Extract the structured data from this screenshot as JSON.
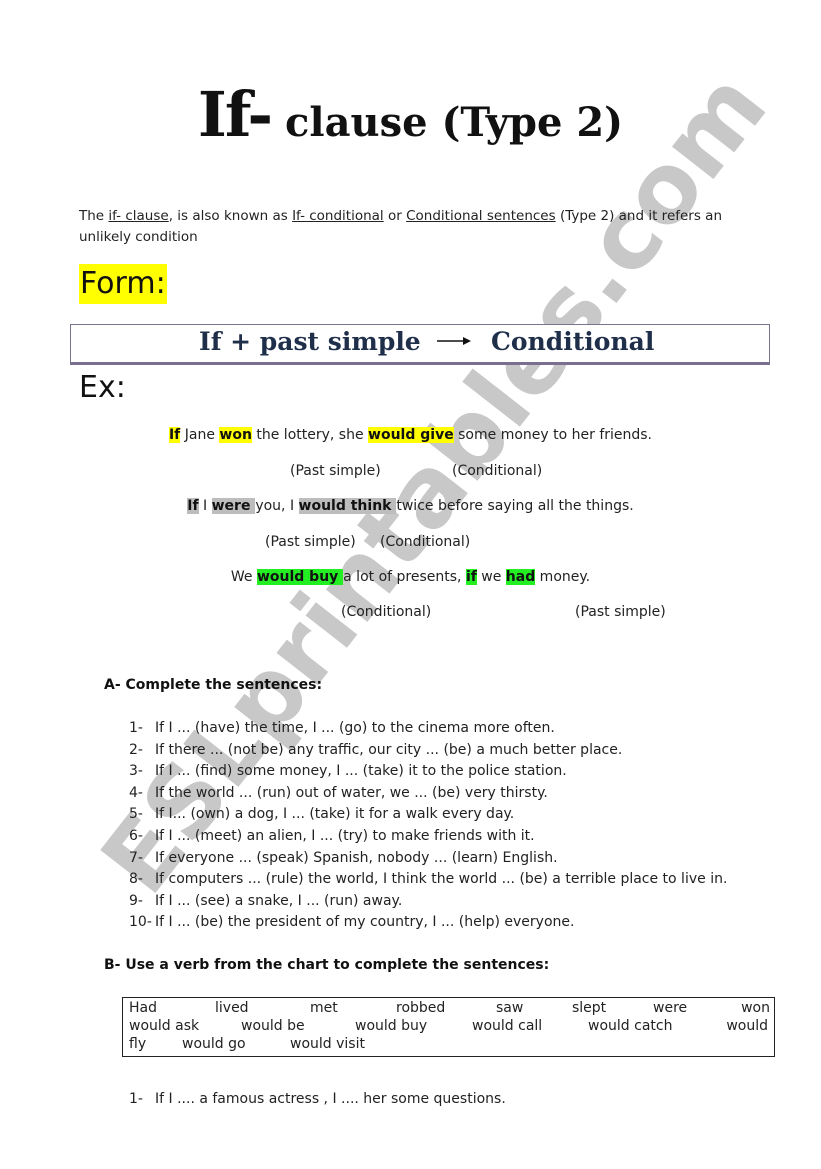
{
  "title": {
    "main": "If-",
    "rest": " clause (Type 2)"
  },
  "intro": {
    "parts": [
      "The ",
      "if- clause",
      ", is also known as ",
      "If- conditional",
      " or ",
      "Conditional sentences",
      " (Type 2) and it refers an unlikely condition"
    ]
  },
  "form": {
    "heading": "Form:",
    "left": "If + past simple",
    "right": "Conditional",
    "arrow_icon": "right-arrow"
  },
  "examples": {
    "heading": "Ex:",
    "sentences": [
      {
        "parts": [
          {
            "text": "If",
            "highlight": "yellow"
          },
          {
            "text": " Jane "
          },
          {
            "text": "won",
            "highlight": "yellow"
          },
          {
            "text": " the lottery, she "
          },
          {
            "text": "would give",
            "highlight": "yellow"
          },
          {
            "text": " some money to her friends."
          }
        ],
        "labels": [
          "(Past simple)",
          "(Conditional)"
        ]
      },
      {
        "parts": [
          {
            "text": "If",
            "highlight": "gray"
          },
          {
            "text": " I "
          },
          {
            "text": "were ",
            "highlight": "gray"
          },
          {
            "text": "you, I "
          },
          {
            "text": "would think ",
            "highlight": "gray"
          },
          {
            "text": "twice before saying all the things."
          }
        ],
        "labels": [
          "(Past simple)",
          "(Conditional)"
        ]
      },
      {
        "parts": [
          {
            "text": "We "
          },
          {
            "text": "would buy ",
            "highlight": "green"
          },
          {
            "text": "a lot of presents, "
          },
          {
            "text": "if",
            "highlight": "green"
          },
          {
            "text": " we "
          },
          {
            "text": "had",
            "highlight": "green"
          },
          {
            "text": " money."
          }
        ],
        "labels": [
          "(Conditional)",
          "(Past simple)"
        ]
      }
    ],
    "highlight_colors": {
      "yellow": "#ffff00",
      "gray": "#bdbdbd",
      "green": "#22ee22"
    }
  },
  "section_a": {
    "heading": "A-  Complete the sentences:",
    "items": [
      {
        "num": "1-",
        "text": "If I ... (have) the time, I ... (go) to the cinema more often."
      },
      {
        "num": "2-",
        "text": "If there ... (not be) any traffic, our city ... (be) a much better place."
      },
      {
        "num": "3-",
        "text": "If I ... (find) some money, I ... (take) it to the police station."
      },
      {
        "num": "4-",
        "text": "If the world ... (run) out of water, we ... (be) very thirsty."
      },
      {
        "num": "5-",
        "text": "If I... (own) a dog, I ... (take) it for a walk every day."
      },
      {
        "num": "6-",
        "text": "If I ... (meet) an alien, I ... (try) to make friends with it."
      },
      {
        "num": "7-",
        "text": "If everyone ... (speak) Spanish, nobody ... (learn) English."
      },
      {
        "num": "8-",
        "text": "If computers ... (rule) the world, I think the world ... (be) a terrible place to live in."
      },
      {
        "num": "9-",
        "text": "If I ... (see) a snake, I ... (run) away."
      },
      {
        "num": "10-",
        "text": "If I ... (be) the president of my country, I ... (help) everyone."
      }
    ]
  },
  "section_b": {
    "heading": "B-  Use a verb from the chart to complete the sentences:",
    "chart_rows": [
      [
        "Had",
        "lived",
        "met",
        "robbed",
        "saw",
        "slept",
        "were",
        "won"
      ],
      [
        "would ask",
        "would be",
        "would buy",
        "would call",
        "would catch",
        "would"
      ],
      [
        "fly",
        "would go",
        "would visit"
      ]
    ],
    "items": [
      {
        "num": "1-",
        "text": "If I .... a famous actress , I .... her some questions."
      }
    ]
  },
  "watermark": {
    "text": "ESLprintables.com",
    "color": "#c8c8c8"
  }
}
